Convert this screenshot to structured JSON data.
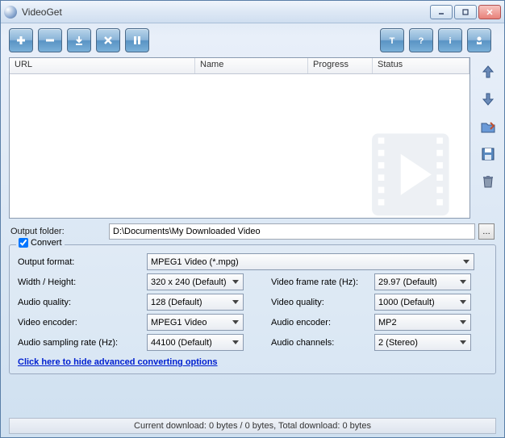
{
  "window": {
    "title": "VideoGet"
  },
  "toolbar": {
    "buttons": [
      "add",
      "remove",
      "download",
      "stop",
      "pause"
    ],
    "rightButtons": [
      "T",
      "help",
      "info",
      "settings"
    ]
  },
  "list": {
    "headers": {
      "url": "URL",
      "name": "Name",
      "progress": "Progress",
      "status": "Status"
    }
  },
  "output": {
    "label": "Output folder:",
    "path": "D:\\Documents\\My Downloaded Video"
  },
  "convert": {
    "checkbox_label": "Convert",
    "format_label": "Output format:",
    "format_value": "MPEG1 Video (*.mpg)",
    "wh_label": "Width / Height:",
    "wh_value": "320 x 240 (Default)",
    "vfr_label": "Video frame rate (Hz):",
    "vfr_value": "29.97 (Default)",
    "aq_label": "Audio quality:",
    "aq_value": "128 (Default)",
    "vq_label": "Video quality:",
    "vq_value": "1000 (Default)",
    "venc_label": "Video encoder:",
    "venc_value": "MPEG1 Video",
    "aenc_label": "Audio encoder:",
    "aenc_value": "MP2",
    "asr_label": "Audio sampling rate (Hz):",
    "asr_value": "44100 (Default)",
    "ach_label": "Audio channels:",
    "ach_value": "2 (Stereo)",
    "adv_link": "Click here to hide advanced converting options"
  },
  "status": {
    "text": "Current download: 0 bytes / 0 bytes,  Total download: 0 bytes"
  }
}
